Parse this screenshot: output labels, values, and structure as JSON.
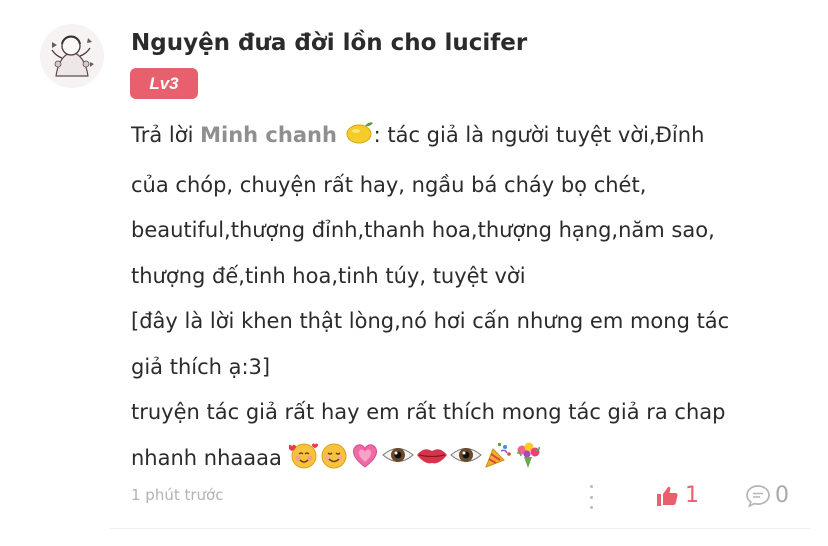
{
  "comment": {
    "username": "Nguyện đưa đời lồn cho lucifer",
    "level_badge": "Lv3",
    "reply_prefix": "Trả lời ",
    "mention": "Minh chanh",
    "line1_rest": ": tác giả là người tuyệt vời,Đỉnh",
    "line2": "của chóp, chuyện rất hay, ngầu bá cháy bọ chét,",
    "line3": "beautiful,thượng đỉnh,thanh hoa,thượng hạng,năm sao,",
    "line4": "thượng đế,tinh hoa,tinh túy, tuyệt vời",
    "line5": "[đây là lời khen thật lòng,nó hơi cấn nhưng em mong tác",
    "line6": "giả thích ạ:3]",
    "line7": "truyện tác giả rất hay em rất thích mong tác giả ra chap",
    "line8": "nhanh nhaaaa",
    "emojis": [
      "smiling-face-with-hearts",
      "smiling-face",
      "growing-heart",
      "eye",
      "lips",
      "eye",
      "party-popper",
      "bouquet"
    ],
    "timestamp": "1 phút trước",
    "like_count": "1",
    "reply_count": "0"
  },
  "colors": {
    "badge": "#e8606d",
    "mention": "#8f8f8f",
    "like": "#e8606d",
    "muted": "#b3b3b3"
  }
}
